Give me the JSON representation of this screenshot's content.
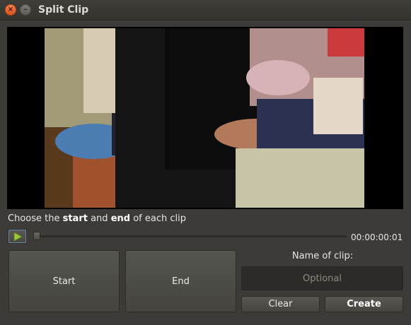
{
  "window": {
    "title": "Split Clip",
    "close_glyph": "×",
    "minimize_glyph": "–"
  },
  "player": {
    "instruction": {
      "part1": "Choose the ",
      "start_word": "start",
      "part2": " and ",
      "end_word": "end",
      "part3": " of each clip"
    },
    "timecode": "00:00:00:01",
    "play_icon": "play-icon",
    "position_fraction": 0.0
  },
  "buttons": {
    "start_label": "Start",
    "end_label": "End",
    "clear_label": "Clear",
    "create_label": "Create"
  },
  "clip_name": {
    "label": "Name of clip:",
    "placeholder": "Optional",
    "value": ""
  },
  "colors": {
    "window_bg": "#3c3b37",
    "close_button": "#e95420",
    "play_icon": "#9fc73a"
  }
}
